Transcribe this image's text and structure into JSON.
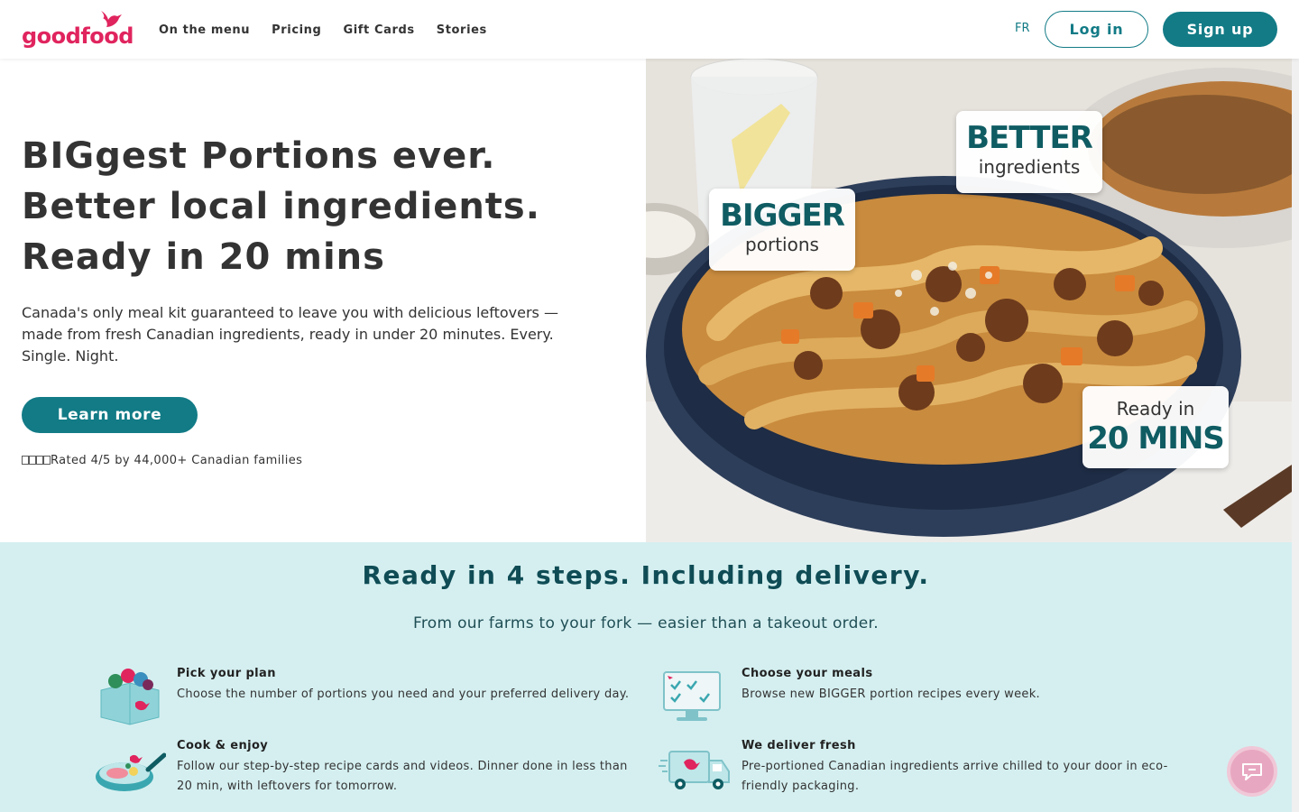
{
  "header": {
    "brand": "goodfood",
    "nav": [
      "On the menu",
      "Pricing",
      "Gift Cards",
      "Stories"
    ],
    "lang": "FR",
    "login_label": "Log in",
    "signup_label": "Sign up"
  },
  "hero": {
    "title_lines": [
      "BIGgest Portions ever.",
      "Better local ingredients.",
      "Ready in 20 mins"
    ],
    "description": "Canada's only meal kit guaranteed to leave you with delicious leftovers — made from fresh Canadian ingredients, ready in under 20 minutes. Every. Single. Night.",
    "cta_label": "Learn more",
    "rating_text": "Rated 4/5 by 44,000+ Canadian families",
    "badges": {
      "bigger": {
        "big": "BIGGER",
        "small": "portions"
      },
      "better": {
        "big": "BETTER",
        "small": "ingredients"
      },
      "ready": {
        "small": "Ready in",
        "big": "20 MINS"
      }
    }
  },
  "steps": {
    "title": "Ready in 4 steps. Including delivery.",
    "subtitle": "From our farms to your fork — easier than a takeout order.",
    "items": [
      {
        "title": "Pick your plan",
        "desc": "Choose the number of portions you need and your preferred delivery day.",
        "icon": "box-icon"
      },
      {
        "title": "Choose your meals",
        "desc": "Browse new BIGGER portion recipes every week.",
        "icon": "menu-screen-icon"
      },
      {
        "title": "Cook & enjoy",
        "desc": "Follow our step-by-step recipe cards and videos. Dinner done in less than 20 min, with leftovers for tomorrow.",
        "icon": "pan-icon"
      },
      {
        "title": "We deliver fresh",
        "desc": "Pre-portioned Canadian ingredients arrive chilled to your door in eco-friendly packaging.",
        "icon": "delivery-truck-icon"
      }
    ]
  },
  "colors": {
    "brand_pink": "#e0245e",
    "teal": "#127b86",
    "steps_bg": "#d5eff0"
  }
}
